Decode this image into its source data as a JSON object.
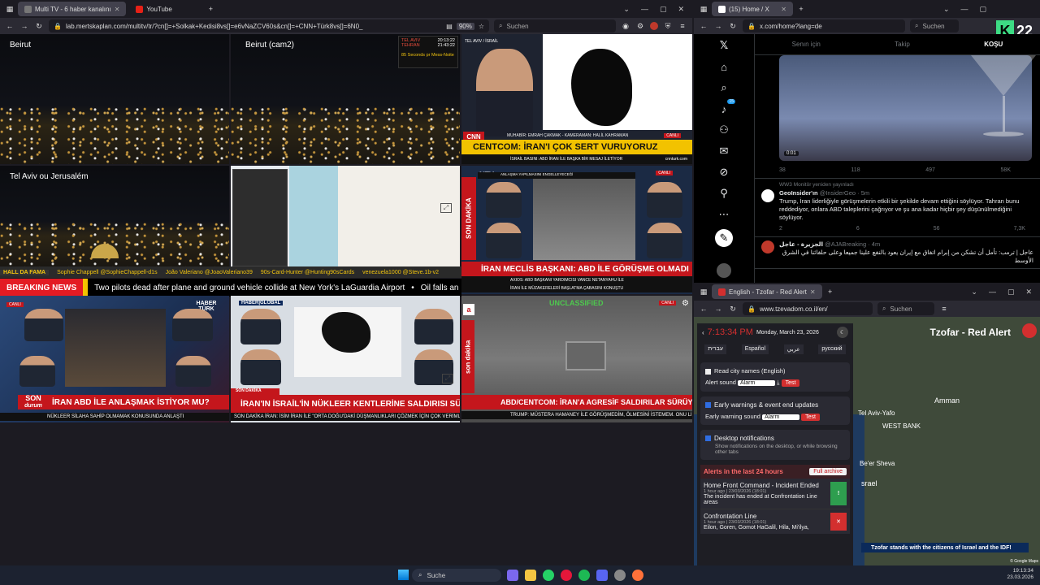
{
  "left_browser": {
    "tabs": [
      {
        "label": "Multi TV - 6 haber kanalını",
        "active": true
      },
      {
        "label": "YouTube",
        "active": false
      }
    ],
    "url": "lab.mertskaplan.com/multitv/tr/?cn[]=+Solkak+Kedisi8vs[]=e6vNaZCV60s&cn[]=+CNN+Türk8vs[]=6N0_",
    "zoom": "90%",
    "search_placeholder": "Suchen"
  },
  "multitv": {
    "cam1": "Beirut",
    "cam2": "Beirut (cam2)",
    "cam3": "Tel Aviv ou Jerusalém",
    "clock_box": {
      "tel_aviv_label": "TEL AVIV",
      "tel_aviv_time": "20:13:22",
      "tehran_label": "TEHRAN",
      "tehran_time": "21:43:22",
      "msg": "85 Seconds pr Mess-Noite"
    },
    "cnn": {
      "tag": "TEL AVIV / İSRAİL",
      "credit": "MUHABİR: EMRAH ÇAKMAK - KAMERAMAN: HALİL KAHRAMAN",
      "headline": "CENTCOM: İRAN'I ÇOK SERT VURUYORUZ",
      "live": "CANLI",
      "ticker": "İSRAİL BASINI: ABD İRAN İLE BAŞKA BİR MESAJ İLETİYOR",
      "site": "cnnturk.com"
    },
    "twitch_ticker": [
      "HALL DA FAMA",
      "Sophie Chappell @SophieChappell-d1s",
      "João Valeriano @JoaoValeriano39",
      "90s-Card-Hunter @Hunting90sCards",
      "venezuela1000 @Steve.1b-v2"
    ],
    "breaking": {
      "tag": "BREAKING NEWS",
      "text": "Two pilots dead after plane and ground vehicle collide at New York's LaGuardia Airport",
      "more": "Oil falls an"
    },
    "ntv": {
      "badge": "CANLI",
      "top": "ANLAŞMA YAPILMASINI ENGELLEYECEĞİ",
      "side": "SON DAKİKA",
      "headline": "İRAN MECLİS BAŞKANI: ABD İLE GÖRÜŞME OLMADI",
      "sub1": "AXIOS: ABD BAŞKANI YARDIMCISI VANCE NETANYAHU İLE",
      "sub2": "İRAN İLE MÜZAKERELERİ BAŞLATMA ÇABASINI KONUŞTU"
    },
    "haberturk1": {
      "badge": "CANLI",
      "brand": "HABER TÜRK",
      "son": "SON",
      "durum": "durum",
      "headline": "İRAN ABD İLE ANLAŞMAK İSTİYOR MU?",
      "ticker": "NÜKLEER SİLAHA SAHİP OLMAMAK KONUSUNDA ANLAŞTI",
      "right": "SON DAKİKA"
    },
    "haberglobal": {
      "brand": "HABER|GLOBAL",
      "side": "SON DAKİKA",
      "headline": "İRAN'IN İSRAİL'İN NÜKLEER KENTLERİNE SALDIRISI SÜRER Mİ?",
      "ticker": "SON DAKİKA İRAN: İSİM İRAN İLE \"ORTA DOĞU'DAKİ DÜŞMANLIKLARI ÇÖZMEK İÇİN ÇOK VERİMLİ\" OLDU"
    },
    "atv": {
      "label": "UNCLASSIFIED",
      "side": "son dakika",
      "headline": "ABD/CENTCOM: İRAN'A AGRESİF SALDIRILAR SÜRÜYOR",
      "ticker": "TRUMP: MÜSTERA HAMANEY İLE GÖRÜŞMEDİM, ÖLMESİNİ İSTEMEM. ONU LİDER OLARAK GÖRMÜYORUM",
      "badge": "CANLI"
    }
  },
  "x_browser": {
    "tab": "(15) Home / X",
    "url": "x.com/home?lang=de",
    "search_placeholder": "Suchen",
    "top_tabs": [
      "Senın için",
      "Takip",
      "KOŞU"
    ],
    "video_time": "0:01",
    "stats1": {
      "replies": "38",
      "retweets": "118",
      "likes": "497",
      "views": "58K"
    },
    "reposted": "WW3 Monitör yeniden yayınladı",
    "tweet1": {
      "name": "GeoInsider'ın",
      "handle": "@InsiderGeo · 5m",
      "text": "Trump, İran liderliğiyle görüşmelerin etkili bir şekilde devam ettiğini söylüyor. Tahran bunu reddediyor, onlara ABD taleplerini çağrıyor ve şu ana kadar hiçbir şey düşünülmediğini söylüyor.",
      "replies": "2",
      "retweets": "6",
      "likes": "56",
      "views": "7,3K"
    },
    "tweet2": {
      "name": "الجزيرة - عاجل",
      "handle": "@AJABreaking · 4m",
      "text": "عاجل | ترمب: تأمل أن تشكن من إبرام اتفاق مع إيران يعود بالنفع علينا جميعا وعلى حلفائنا في الشرق الأوسط"
    },
    "notif_count": "15",
    "logo_k": "K",
    "logo_num": "22"
  },
  "tz_browser": {
    "tab": "English - Tzofar - Red Alert",
    "url": "www.tzevadom.co.il/en/",
    "search_placeholder": "Suchen",
    "time": "7:13:34 PM",
    "date": "Monday, March 23, 2026",
    "langs": [
      "עברית",
      "Español",
      "عربي",
      "русский"
    ],
    "read_city": "Read city names (English)",
    "alert_sound_label": "Alert sound",
    "alert_sound_value": "Alarm",
    "test": "Test",
    "early_label": "Early warnings & event end updates",
    "early_sound_label": "Early warning sound",
    "desktop_label": "Desktop notifications",
    "desktop_sub": "Show notifications on the desktop, or while browsing other tabs",
    "alerts_title": "Alerts in the last 24 hours",
    "full_archive": "Full archive",
    "alert1": {
      "title": "Home Front Command - Incident Ended",
      "time": "1 hour ago | 23/03/2026 (18:01)",
      "body": "The incident has ended at Confrontation Line areas"
    },
    "alert2": {
      "title": "Confrontation Line",
      "time": "1 hour ago | 23/03/2026 (18:01)",
      "body": "Eilon, Goren, Gomot HaGalil, Hila, Mi'ilya,"
    },
    "map_title": "Tzofar - Red Alert",
    "map_places": [
      "Tel Aviv-Yafo",
      "Amman",
      "WEST BANK",
      "Be'er Sheva",
      "srael"
    ],
    "banner": "Tzofar stands with the citizens of Israel and the IDF!",
    "google": "© Google Maps"
  },
  "taskbar": {
    "search": "Suche",
    "time": "19:13:34",
    "date": "23.03.2026"
  }
}
